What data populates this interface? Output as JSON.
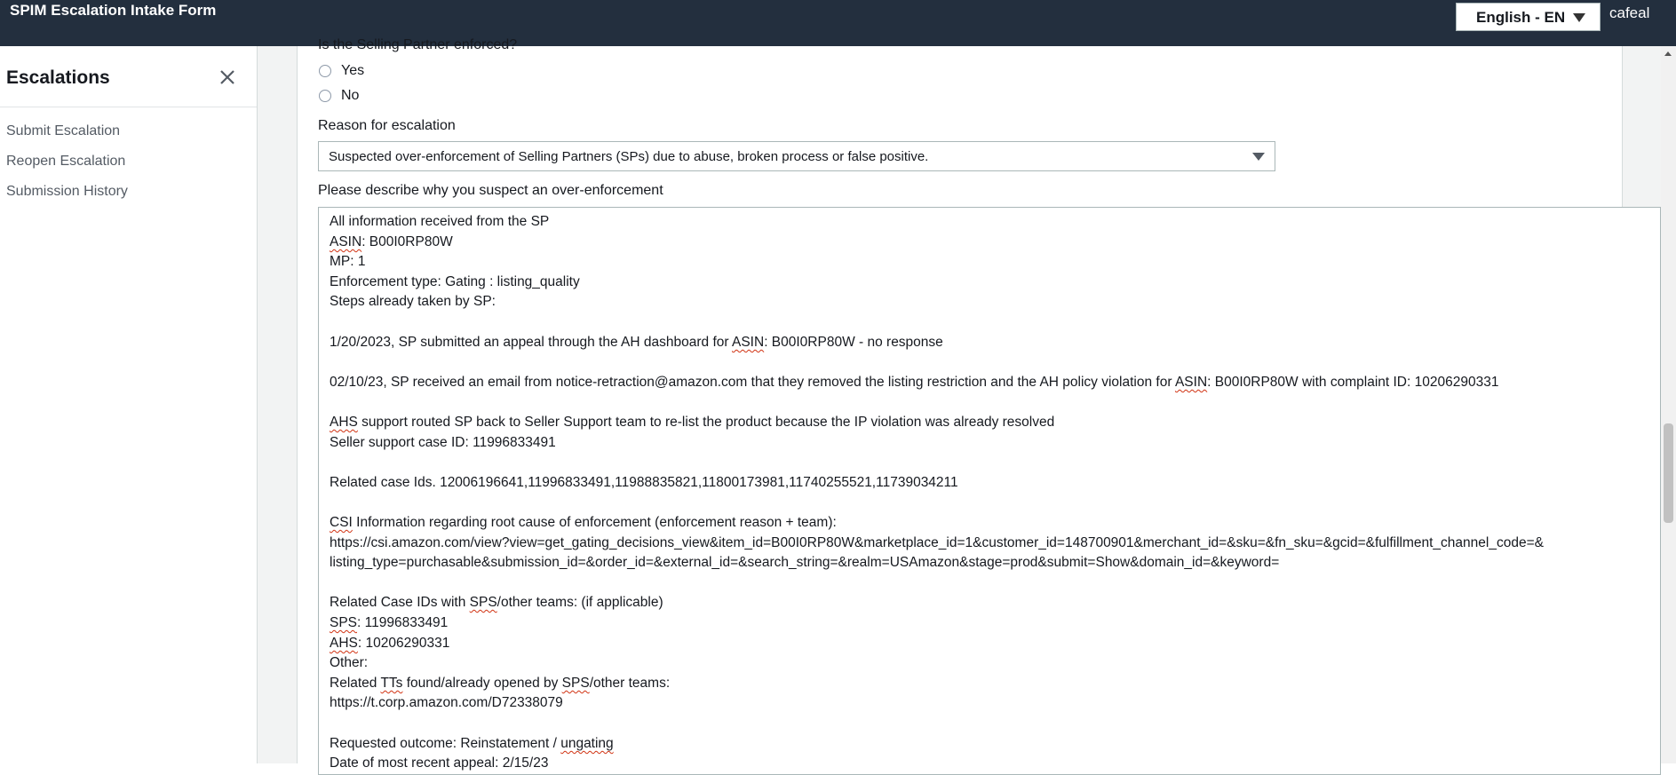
{
  "header": {
    "title": "SPIM Escalation Intake Form",
    "language": "English - EN",
    "username": "cafeal"
  },
  "sidebar": {
    "title": "Escalations",
    "items": [
      {
        "label": "Submit Escalation"
      },
      {
        "label": "Reopen Escalation"
      },
      {
        "label": "Submission History"
      }
    ]
  },
  "form": {
    "enforced_question": "Is the Selling Partner enforced?",
    "enforced_options": [
      "Yes",
      "No"
    ],
    "reason_label": "Reason for escalation",
    "reason_value": "Suspected over-enforcement of Selling Partners (SPs) due to abuse, broken process or false positive.",
    "description_label": "Please describe why you suspect an over-enforcement",
    "description_lines": [
      "All information received from the SP",
      "ASIN: B00I0RP80W",
      "MP: 1",
      "Enforcement type: Gating : listing_quality",
      "Steps already taken by SP:",
      "",
      "1/20/2023, SP submitted an appeal through the AH dashboard for ASIN: B00I0RP80W - no response",
      "",
      "02/10/23, SP received an email from notice-retraction@amazon.com that they removed the listing restriction and the AH policy violation for ASIN: B00I0RP80W with complaint ID: 10206290331",
      "",
      "AHS support routed SP back to Seller Support team to re-list the product because the IP violation was already resolved",
      "Seller support case ID: 11996833491",
      "",
      "Related case Ids. 12006196641,11996833491,11988835821,11800173981,11740255521,11739034211",
      "",
      "CSI Information regarding root cause of enforcement (enforcement reason + team):",
      "https://csi.amazon.com/view?view=get_gating_decisions_view&item_id=B00I0RP80W&marketplace_id=1&customer_id=148700901&merchant_id=&sku=&fn_sku=&gcid=&fulfillment_channel_code=&",
      "listing_type=purchasable&submission_id=&order_id=&external_id=&search_string=&realm=USAmazon&stage=prod&submit=Show&domain_id=&keyword=",
      "",
      "Related Case IDs with SPS/other teams: (if applicable)",
      "SPS: 11996833491",
      "AHS: 10206290331",
      "Other:",
      "Related TTs found/already opened by SPS/other teams:",
      "https://t.corp.amazon.com/D72338079",
      "",
      "Requested outcome: Reinstatement / ungating",
      "Date of most recent appeal: 2/15/23"
    ]
  }
}
